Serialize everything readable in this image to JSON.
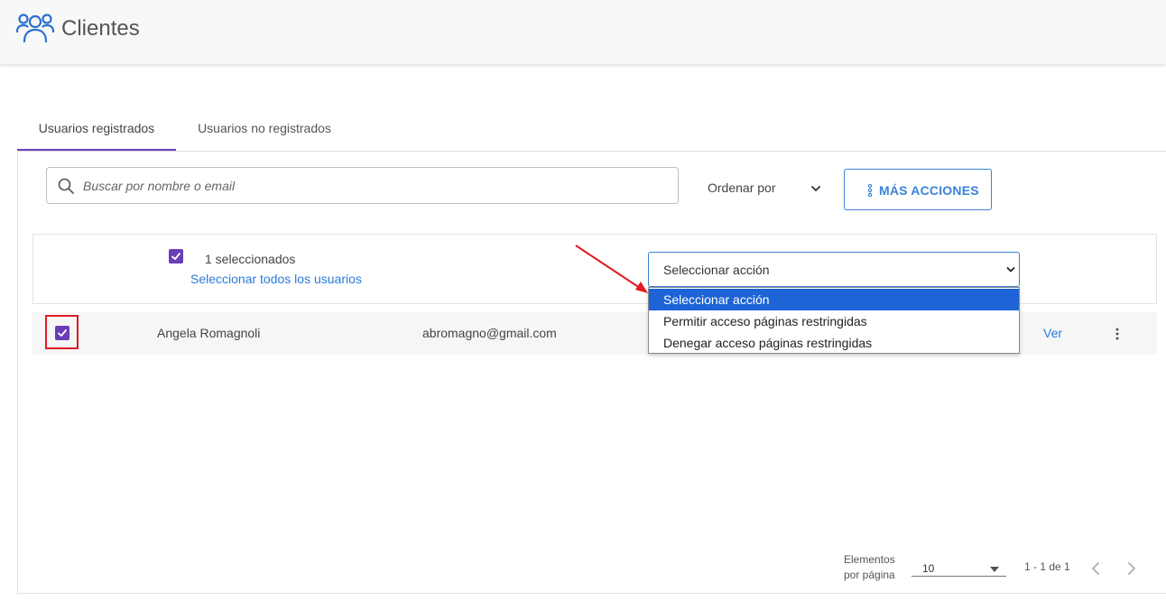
{
  "header": {
    "title": "Clientes",
    "icon": "users-icon",
    "accent_color": "#2a6fd0"
  },
  "tabs": [
    {
      "label": "Usuarios registrados",
      "active": true
    },
    {
      "label": "Usuarios no registrados",
      "active": false
    }
  ],
  "toolbar": {
    "search_placeholder": "Buscar por nombre o email",
    "order_by_label": "Ordenar por",
    "more_actions_label": "MÁS ACCIONES"
  },
  "selection": {
    "count_label": "1 seleccionados",
    "select_all_label": "Seleccionar todos los usuarios",
    "checked": true
  },
  "action_select": {
    "value": "Seleccionar acción",
    "options": [
      "Seleccionar acción",
      "Permitir acceso páginas restringidas",
      "Denegar acceso páginas restringidas"
    ],
    "selected_index": 0
  },
  "rows": [
    {
      "name": "Angela Romagnoli",
      "email": "abromagno@gmail.com",
      "view_label": "Ver",
      "checked": true
    }
  ],
  "pagination": {
    "items_per_page_label_1": "Elementos",
    "items_per_page_label_2": "por página",
    "items_per_page": "10",
    "range_label": "1 - 1 de 1"
  },
  "colors": {
    "tab_active": "#6f3fc0",
    "checkbox": "#6a3db8",
    "link": "#2a7bd6",
    "option_highlight": "#1e64d6",
    "annotation": "#e01b24"
  }
}
